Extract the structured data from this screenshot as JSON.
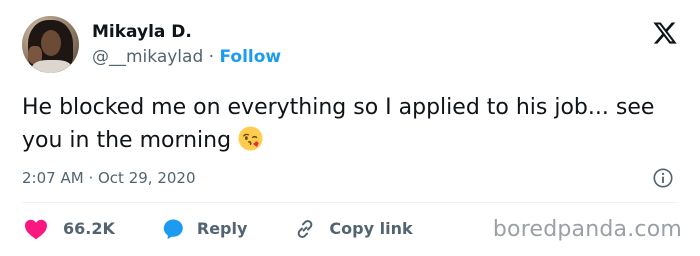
{
  "user": {
    "display_name": "Mikayla D.",
    "handle": "@__mikaylad",
    "separator": "·",
    "follow_label": "Follow"
  },
  "tweet": {
    "text": "He blocked me on everything so I applied to his job... see you in the morning",
    "emoji": "face-blowing-a-kiss",
    "time": "2:07 AM",
    "date": "Oct 29, 2020",
    "timestamp_separator": "·"
  },
  "actions": {
    "like_count": "66.2K",
    "reply_label": "Reply",
    "copy_link_label": "Copy link"
  },
  "icons": {
    "logo": "x-logo-icon",
    "info": "info-icon",
    "like": "heart-icon",
    "reply": "reply-bubble-icon",
    "copy_link": "link-icon"
  },
  "watermark": "boredpanda.com",
  "colors": {
    "link_blue": "#1d9bf0",
    "like_pink": "#f91880",
    "text_primary": "#0f1419",
    "text_secondary": "#536471",
    "watermark_gray": "#9aa0a6"
  }
}
